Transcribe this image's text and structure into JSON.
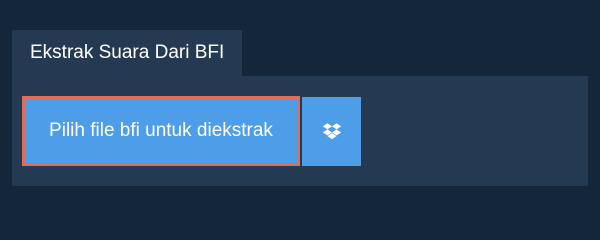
{
  "tab": {
    "label": "Ekstrak Suara Dari BFI"
  },
  "upload": {
    "button_label": "Pilih file bfi untuk diekstrak"
  },
  "dropbox": {
    "icon": "dropbox-icon"
  },
  "colors": {
    "page_background": "#14263a",
    "panel_background": "#233a52",
    "button_blue": "#4d9de8",
    "focus_outline": "#e06c5a",
    "text": "#ffffff"
  }
}
